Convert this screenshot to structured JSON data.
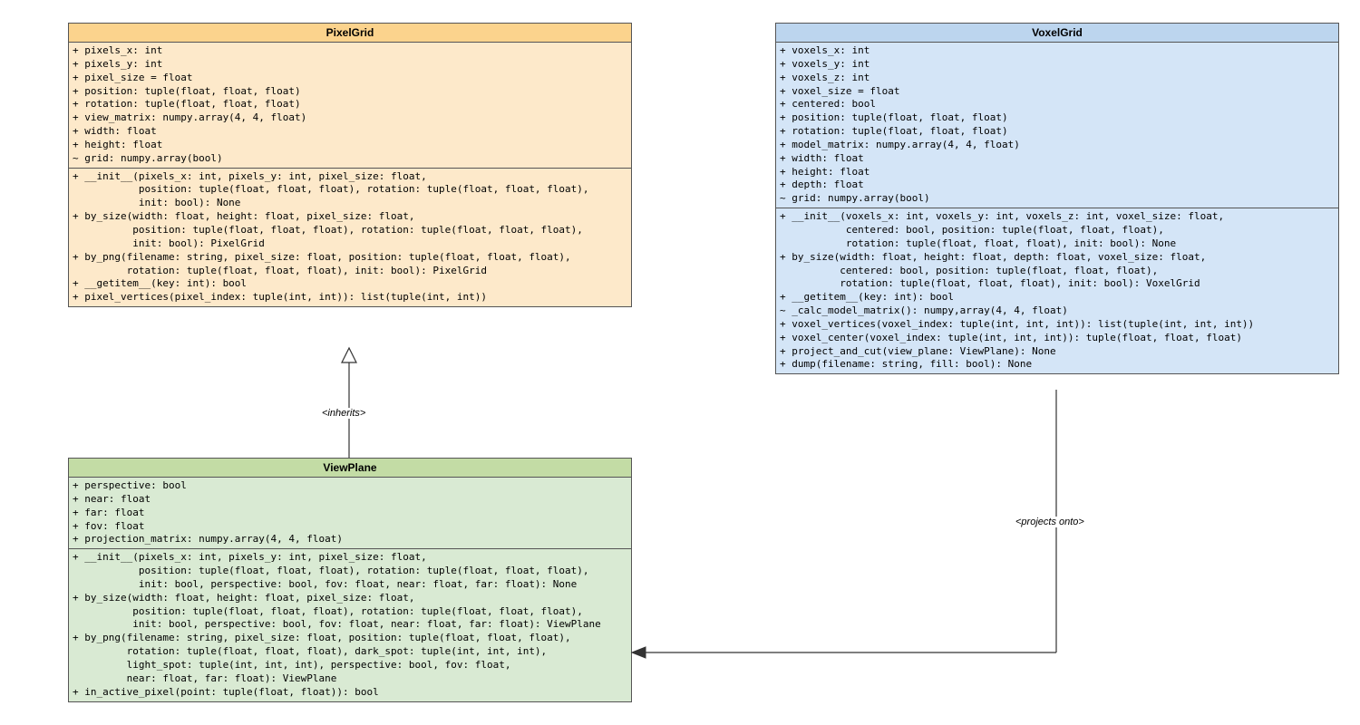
{
  "classes": {
    "pixelgrid": {
      "name": "PixelGrid",
      "attrs": "+ pixels_x: int\n+ pixels_y: int\n+ pixel_size = float\n+ position: tuple(float, float, float)\n+ rotation: tuple(float, float, float)\n+ view_matrix: numpy.array(4, 4, float)\n+ width: float\n+ height: float\n~ grid: numpy.array(bool)",
      "methods": "+ __init__(pixels_x: int, pixels_y: int, pixel_size: float,\n           position: tuple(float, float, float), rotation: tuple(float, float, float),\n           init: bool): None\n+ by_size(width: float, height: float, pixel_size: float,\n          position: tuple(float, float, float), rotation: tuple(float, float, float),\n          init: bool): PixelGrid\n+ by_png(filename: string, pixel_size: float, position: tuple(float, float, float),\n         rotation: tuple(float, float, float), init: bool): PixelGrid\n+ __getitem__(key: int): bool\n+ pixel_vertices(pixel_index: tuple(int, int)): list(tuple(int, int))"
    },
    "voxelgrid": {
      "name": "VoxelGrid",
      "attrs": "+ voxels_x: int\n+ voxels_y: int\n+ voxels_z: int\n+ voxel_size = float\n+ centered: bool\n+ position: tuple(float, float, float)\n+ rotation: tuple(float, float, float)\n+ model_matrix: numpy.array(4, 4, float)\n+ width: float\n+ height: float\n+ depth: float\n~ grid: numpy.array(bool)",
      "methods": "+ __init__(voxels_x: int, voxels_y: int, voxels_z: int, voxel_size: float,\n           centered: bool, position: tuple(float, float, float),\n           rotation: tuple(float, float, float), init: bool): None\n+ by_size(width: float, height: float, depth: float, voxel_size: float,\n          centered: bool, position: tuple(float, float, float),\n          rotation: tuple(float, float, float), init: bool): VoxelGrid\n+ __getitem__(key: int): bool\n~ _calc_model_matrix(): numpy,array(4, 4, float)\n+ voxel_vertices(voxel_index: tuple(int, int, int)): list(tuple(int, int, int))\n+ voxel_center(voxel_index: tuple(int, int, int)): tuple(float, float, float)\n+ project_and_cut(view_plane: ViewPlane): None\n+ dump(filename: string, fill: bool): None"
    },
    "viewplane": {
      "name": "ViewPlane",
      "attrs": "+ perspective: bool\n+ near: float\n+ far: float\n+ fov: float\n+ projection_matrix: numpy.array(4, 4, float)",
      "methods": "+ __init__(pixels_x: int, pixels_y: int, pixel_size: float,\n           position: tuple(float, float, float), rotation: tuple(float, float, float),\n           init: bool, perspective: bool, fov: float, near: float, far: float): None\n+ by_size(width: float, height: float, pixel_size: float,\n          position: tuple(float, float, float), rotation: tuple(float, float, float),\n          init: bool, perspective: bool, fov: float, near: float, far: float): ViewPlane\n+ by_png(filename: string, pixel_size: float, position: tuple(float, float, float),\n         rotation: tuple(float, float, float), dark_spot: tuple(int, int, int),\n         light_spot: tuple(int, int, int), perspective: bool, fov: float,\n         near: float, far: float): ViewPlane\n+ in_active_pixel(point: tuple(float, float)): bool"
    }
  },
  "relations": {
    "inherits": "<inherits>",
    "projects": "<projects onto>"
  },
  "chart_data": {
    "type": "uml-class-diagram",
    "classes": [
      {
        "id": "PixelGrid",
        "color": "orange"
      },
      {
        "id": "VoxelGrid",
        "color": "blue"
      },
      {
        "id": "ViewPlane",
        "color": "green"
      }
    ],
    "relations": [
      {
        "from": "ViewPlane",
        "to": "PixelGrid",
        "kind": "inherits",
        "label": "<inherits>"
      },
      {
        "from": "VoxelGrid",
        "to": "ViewPlane",
        "kind": "projects onto",
        "label": "<projects onto>"
      }
    ]
  }
}
